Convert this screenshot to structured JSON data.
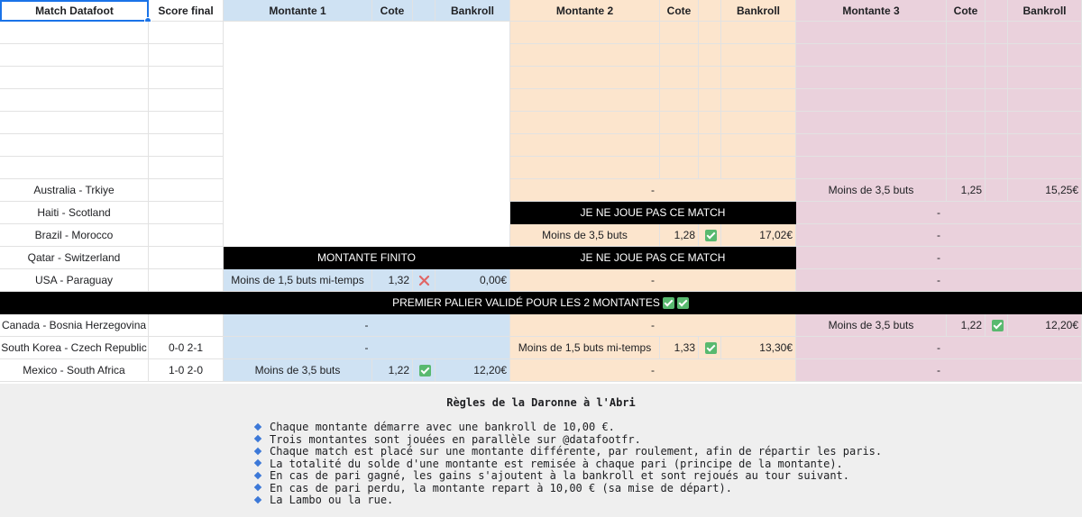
{
  "headers": {
    "match": "Match Datafoot",
    "score": "Score final",
    "m1": "Montante 1",
    "m1_cote": "Cote",
    "m1_bank": "Bankroll",
    "m2": "Montante 2",
    "m2_cote": "Cote",
    "m2_bank": "Bankroll",
    "m3": "Montante 3",
    "m3_cote": "Cote",
    "m3_bank": "Bankroll"
  },
  "rows": [
    {
      "match": "",
      "score": ""
    },
    {
      "match": "",
      "score": ""
    },
    {
      "match": "",
      "score": ""
    },
    {
      "match": "",
      "score": ""
    },
    {
      "match": "",
      "score": ""
    },
    {
      "match": "",
      "score": ""
    },
    {
      "match": "",
      "score": ""
    },
    {
      "match": "Australia - Trkiye",
      "score": "",
      "m2_dash": "-",
      "m3_bet": "Moins de 3,5 buts",
      "m3_cote": "1,25",
      "m3_bank": "15,25€"
    },
    {
      "match": "Haiti - Scotland",
      "score": "",
      "m2_banner": "JE NE JOUE PAS CE MATCH",
      "m3_dash": "-"
    },
    {
      "match": "Brazil - Morocco",
      "score": "",
      "m2_bet": "Moins de 3,5 buts",
      "m2_cote": "1,28",
      "m2_bank": "17,02€",
      "m3_dash": "-"
    },
    {
      "match": "Qatar - Switzerland",
      "score": "",
      "m1_banner": "MONTANTE FINITO",
      "m2_banner": "JE NE JOUE PAS CE MATCH",
      "m3_dash": "-"
    },
    {
      "match": "USA - Paraguay",
      "score": "",
      "m1_bet": "Moins de 1,5 buts mi-temps",
      "m1_cote": "1,32",
      "m1_bank": "0,00€",
      "m2_dash": "-",
      "m3_dash": "-"
    },
    {
      "banner": "PREMIER PALIER VALIDÉ POUR LES 2 MONTANTES"
    },
    {
      "match": "Canada - Bosnia Herzegovina",
      "score": "",
      "m1_dash": "-",
      "m2_dash": "-",
      "m3_bet": "Moins de 3,5 buts",
      "m3_cote": "1,22",
      "m3_bank": "12,20€"
    },
    {
      "match": "South Korea - Czech Republic",
      "score": "0-0 2-1",
      "m1_dash": "-",
      "m2_bet": "Moins de 1,5 buts mi-temps",
      "m2_cote": "1,33",
      "m2_bank": "13,30€",
      "m3_dash": "-"
    },
    {
      "match": "Mexico - South Africa",
      "score": "1-0 2-0",
      "m1_bet": "Moins de 3,5 buts",
      "m1_cote": "1,22",
      "m1_bank": "12,20€",
      "m2_dash": "-",
      "m3_dash": "-"
    }
  ],
  "status_icons": {
    "lost": "cross-icon",
    "won": "check-icon",
    "lost_color": "#e06666",
    "won_color": "#59b96f"
  },
  "colors": {
    "montante1": "#cfe2f3",
    "montante2": "#fce5cd",
    "montante3": "#ead1dc",
    "banner": "#000000"
  },
  "rules": {
    "title": "Règles de la Daronne à l'Abri",
    "items": [
      "Chaque montante démarre avec une bankroll de 10,00 €.",
      "Trois montantes sont jouées en parallèle sur @datafootfr.",
      "Chaque match est placé sur une montante différente, par roulement, afin de répartir les paris.",
      "La totalité du solde d'une montante est remisée à chaque pari (principe de la montante).",
      "En cas de pari gagné, les gains s'ajoutent à la bankroll et sont rejoués au tour suivant.",
      "En cas de pari perdu, la montante repart à 10,00 € (sa mise de départ).",
      "La Lambo ou la rue."
    ]
  }
}
